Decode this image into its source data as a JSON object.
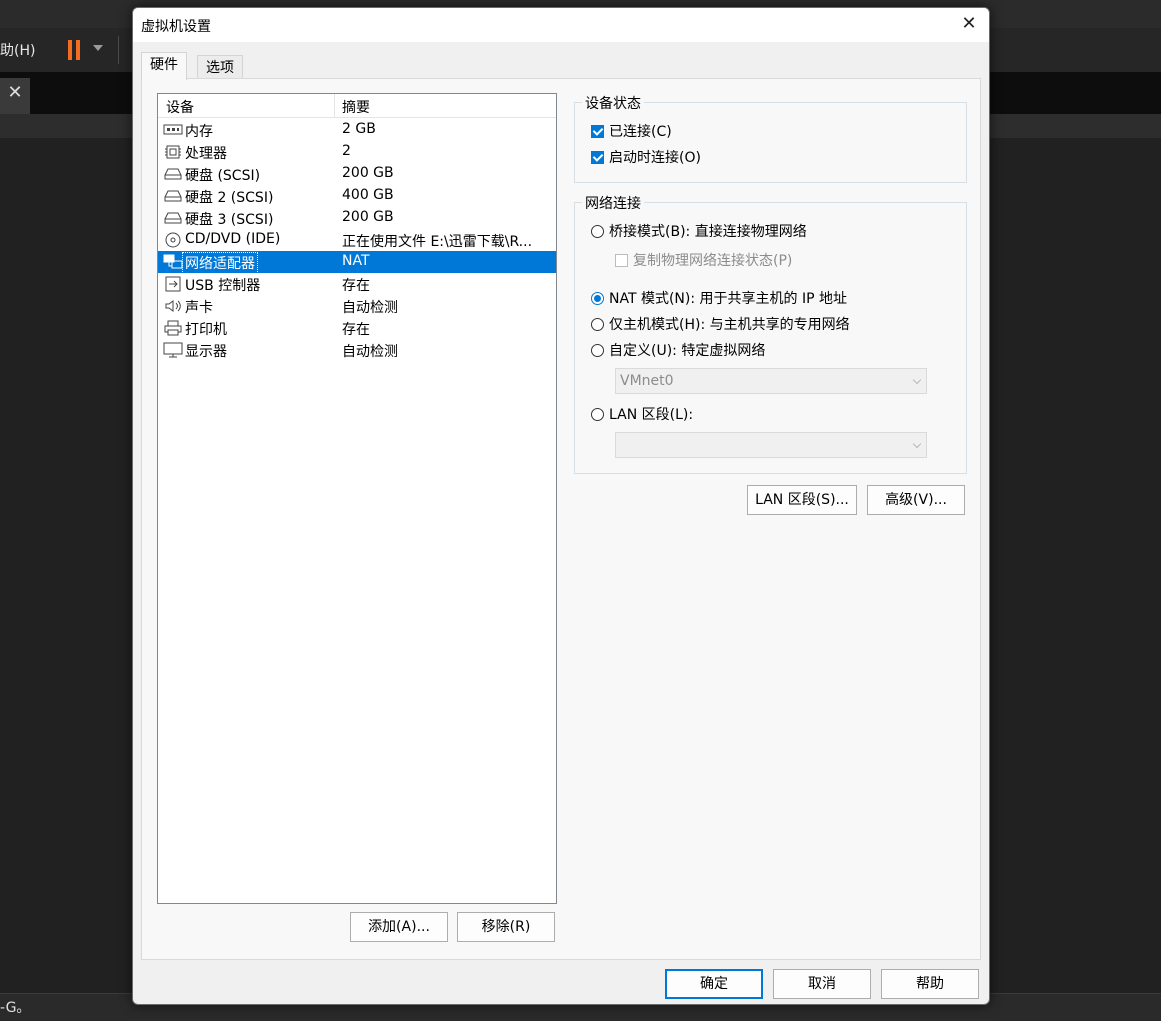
{
  "background_app": {
    "menu_help": "助(H)",
    "status_text": "-G。"
  },
  "dialog": {
    "title": "虚拟机设置",
    "tabs": [
      {
        "label": "硬件",
        "active": true
      },
      {
        "label": "选项",
        "active": false
      }
    ],
    "device_list": {
      "columns": [
        "设备",
        "摘要"
      ],
      "rows": [
        {
          "name": "内存",
          "summary": "2 GB",
          "icon": "memory-icon",
          "selected": false
        },
        {
          "name": "处理器",
          "summary": "2",
          "icon": "cpu-icon",
          "selected": false
        },
        {
          "name": "硬盘 (SCSI)",
          "summary": "200 GB",
          "icon": "hard-disk-icon",
          "selected": false
        },
        {
          "name": "硬盘 2 (SCSI)",
          "summary": "400 GB",
          "icon": "hard-disk-icon",
          "selected": false
        },
        {
          "name": "硬盘 3 (SCSI)",
          "summary": "200 GB",
          "icon": "hard-disk-icon",
          "selected": false
        },
        {
          "name": "CD/DVD (IDE)",
          "summary": "正在使用文件 E:\\迅雷下载\\R...",
          "icon": "cd-dvd-icon",
          "selected": false
        },
        {
          "name": "网络适配器",
          "summary": "NAT",
          "icon": "network-adapter-icon",
          "selected": true
        },
        {
          "name": "USB 控制器",
          "summary": "存在",
          "icon": "usb-icon",
          "selected": false
        },
        {
          "name": "声卡",
          "summary": "自动检测",
          "icon": "speaker-icon",
          "selected": false
        },
        {
          "name": "打印机",
          "summary": "存在",
          "icon": "printer-icon",
          "selected": false
        },
        {
          "name": "显示器",
          "summary": "自动检测",
          "icon": "monitor-icon",
          "selected": false
        }
      ]
    },
    "add_button": "添加(A)...",
    "remove_button": "移除(R)",
    "device_status": {
      "title": "设备状态",
      "connected": {
        "label": "已连接(C)",
        "checked": true
      },
      "connect_at_power_on": {
        "label": "启动时连接(O)",
        "checked": true
      }
    },
    "network_connection": {
      "title": "网络连接",
      "bridged": {
        "label": "桥接模式(B): 直接连接物理网络",
        "selected": false
      },
      "replicate_state": {
        "label": "复制物理网络连接状态(P)",
        "checked": false,
        "disabled": true
      },
      "nat": {
        "label": "NAT 模式(N): 用于共享主机的 IP 地址",
        "selected": true
      },
      "host_only": {
        "label": "仅主机模式(H): 与主机共享的专用网络",
        "selected": false
      },
      "custom": {
        "label": "自定义(U): 特定虚拟网络",
        "selected": false
      },
      "custom_select": "VMnet0",
      "lan_segment": {
        "label": "LAN 区段(L):",
        "selected": false
      },
      "lan_segment_select": ""
    },
    "lan_segments_button": "LAN 区段(S)...",
    "advanced_button": "高级(V)...",
    "ok_button": "确定",
    "cancel_button": "取消",
    "help_button": "帮助",
    "colors": {
      "selection": "#0078d7",
      "accent_pause": "#f36c21"
    }
  }
}
